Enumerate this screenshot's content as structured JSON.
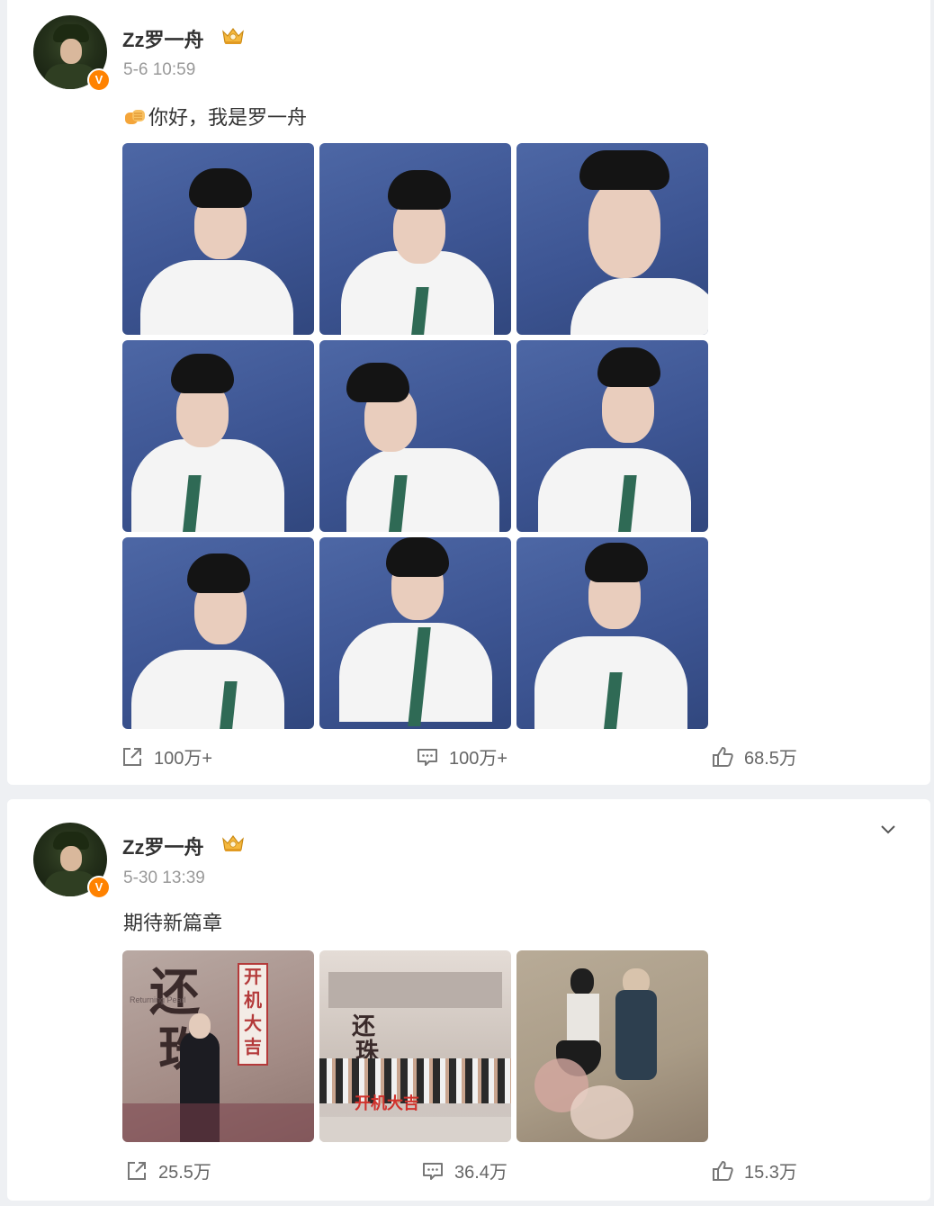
{
  "posts": [
    {
      "username": "Zz罗一舟",
      "time": "5-6 10:59",
      "text": "你好，我是罗一舟",
      "emoji": "fist-bump-emoji",
      "images": 9,
      "actions": {
        "repost": "100万+",
        "comment": "100万+",
        "like": "68.5万"
      }
    },
    {
      "username": "Zz罗一舟",
      "time": "5-30 13:39",
      "text": "期待新篇章",
      "images": 3,
      "image_text": {
        "title_chars": [
          "还",
          "珠"
        ],
        "subtitle": "Returning Pearl",
        "banner": "开机大吉",
        "banner2": "开机大吉"
      },
      "actions": {
        "repost": "25.5万",
        "comment": "36.4万",
        "like": "15.3万"
      }
    }
  ],
  "colors": {
    "accent": "#ff8200",
    "background": "#eef0f3",
    "card": "#ffffff",
    "muted": "#999999"
  },
  "icons": [
    "crown-badge-icon",
    "verified-v-icon",
    "repost-icon",
    "comment-icon",
    "like-icon",
    "chevron-down-icon"
  ]
}
